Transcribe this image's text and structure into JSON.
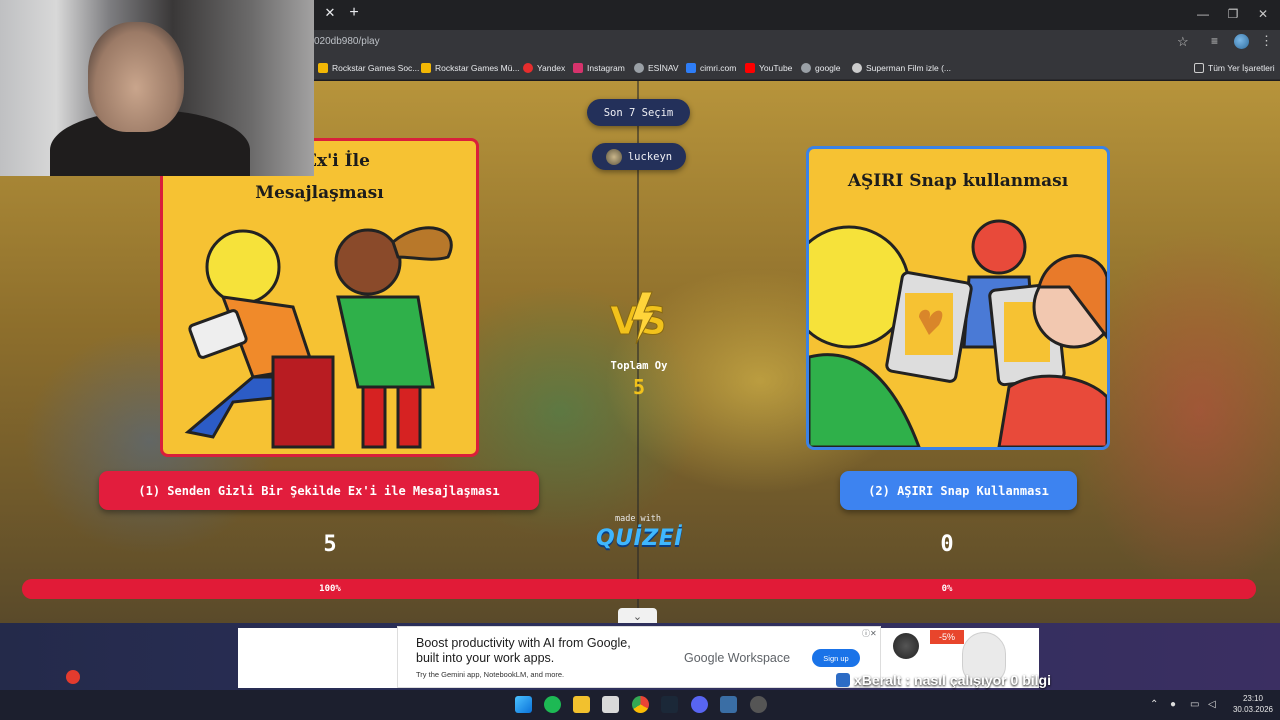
{
  "browser": {
    "url": "020db980/play",
    "bookmarks": [
      {
        "label": "Rockstar Games Soc...",
        "color": "#f2b705"
      },
      {
        "label": "Rockstar Games Mü...",
        "color": "#f2b705"
      },
      {
        "label": "Yandex",
        "color": "#e62d2d"
      },
      {
        "label": "Instagram",
        "color": "#d6336c"
      },
      {
        "label": "ESİNAV",
        "color": "#9aa0a6"
      },
      {
        "label": "cimri.com",
        "color": "#2e7df6"
      },
      {
        "label": "YouTube",
        "color": "#ff0000"
      },
      {
        "label": "google",
        "color": "#9aa0a6"
      },
      {
        "label": "Superman Film izle (...",
        "color": "#cccccc"
      }
    ],
    "all_bookmarks": "Tüm Yer İşaretleri"
  },
  "game": {
    "recent_label": "Son 7 Seçim",
    "username": "luckeyn",
    "total_label": "Toplam Oy",
    "total_value": "5",
    "made_with": "made with",
    "brand": "QUİZEİ",
    "left_card_title_1": "izli Ex'i İle",
    "left_card_title_2": "Mesajlaşması",
    "right_card_title": "AŞIRI Snap kullanması",
    "option1_label": "(1) Senden Gizli Bir Şekilde Ex'i ile Mesajlaşması",
    "option2_label": "(2) AŞIRI Snap Kullanması",
    "option1_votes": "5",
    "option2_votes": "0",
    "option1_pct": "100%",
    "option2_pct": "0%",
    "option1_share": 1.0,
    "accent_left": "#e21d3d",
    "accent_right": "#3d83f0"
  },
  "ad": {
    "line1": "Boost productivity with AI from Google,",
    "line2": "built into your work apps.",
    "line3": "Try the Gemini app, NotebookLM, and more.",
    "brand": "Google Workspace",
    "cta": "Sign up",
    "sale_badge": "-5%"
  },
  "chat": {
    "msg1_user": "xBeralt",
    "msg1_text": ": nasıl çalışıyor 0 bilgi",
    "msg2_user": "xBeralt",
    "msg2_text": ":"
  },
  "taskbar": {
    "time": "23:10",
    "date": "30.03.2026"
  }
}
